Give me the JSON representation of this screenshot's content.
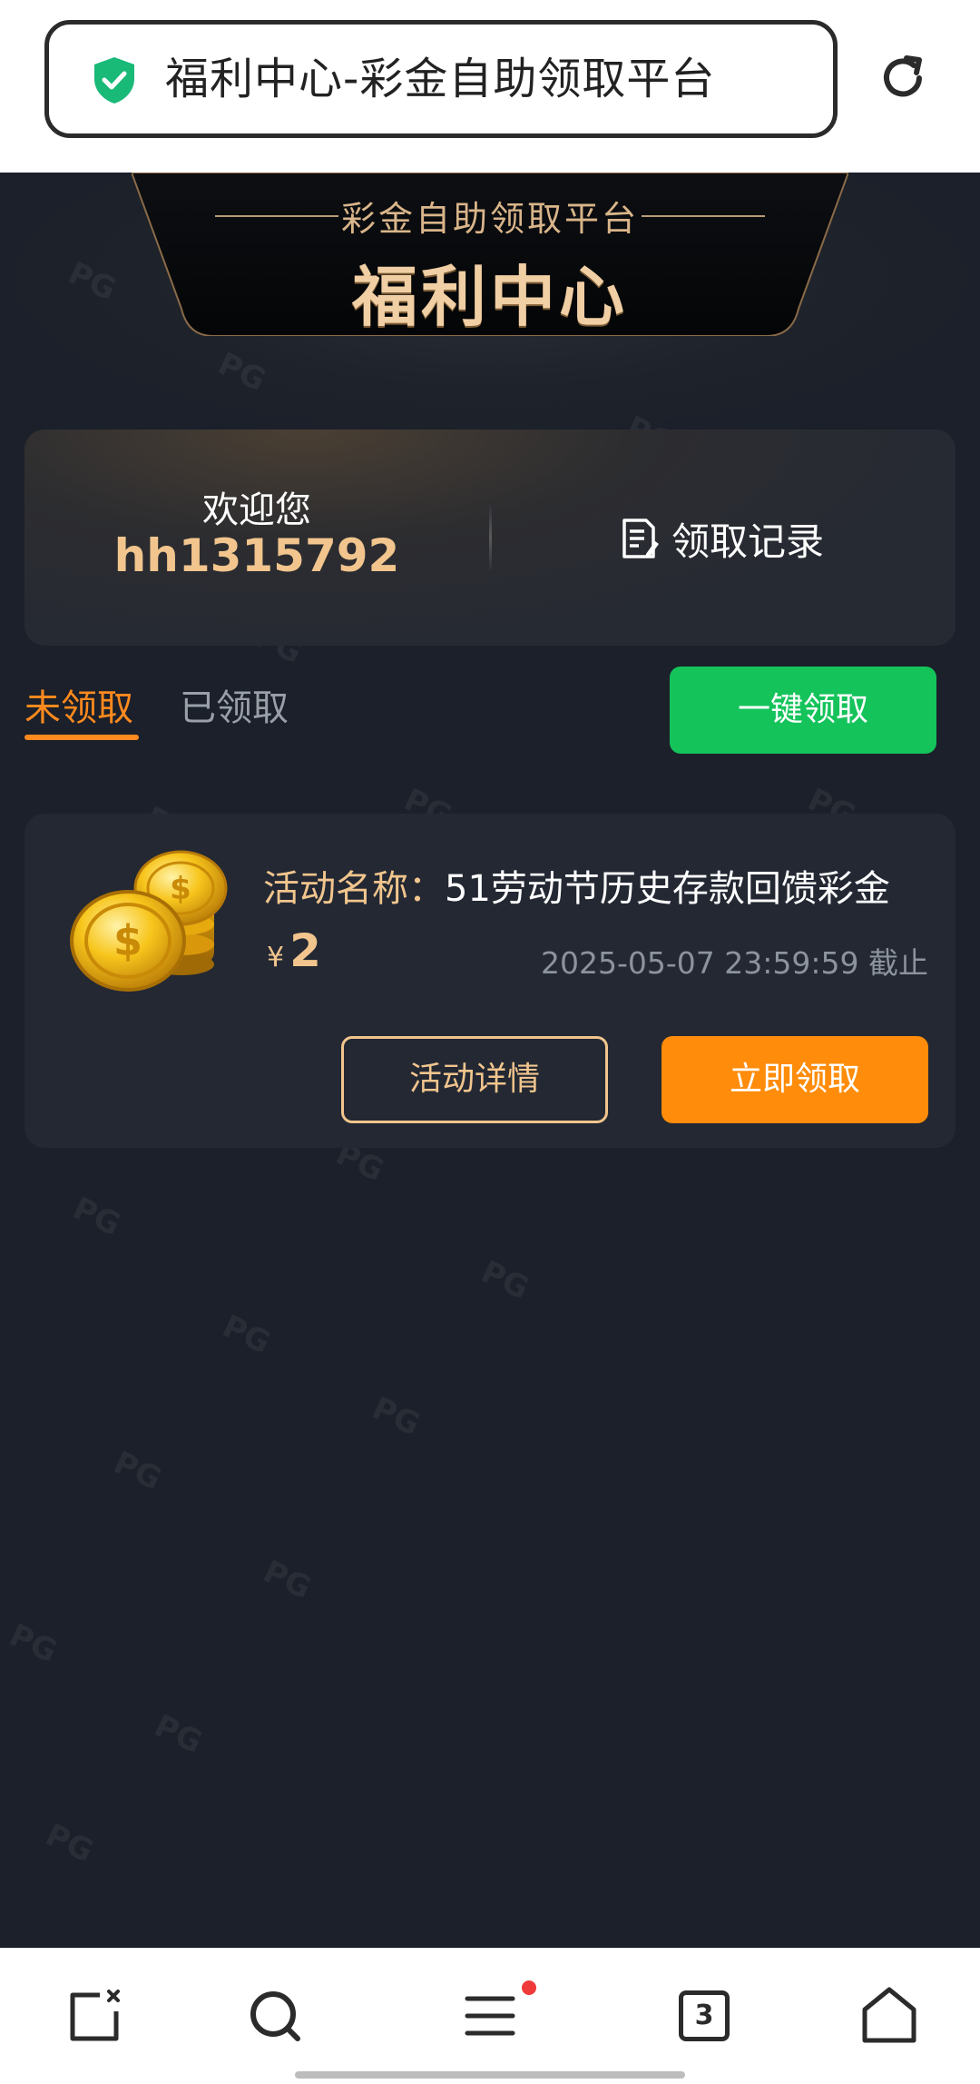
{
  "browser": {
    "address_title": "福利中心-彩金自助领取平台",
    "tab_count": "3"
  },
  "hero": {
    "subtitle": "彩金自助领取平台",
    "title": "福利中心"
  },
  "user": {
    "welcome": "欢迎您",
    "username": "hh1315792",
    "record_label": "领取记录"
  },
  "tabs": {
    "unclaimed": "未领取",
    "claimed": "已领取",
    "claim_all": "一键领取"
  },
  "activity": {
    "name_label": "活动名称：",
    "name": "51劳动节历史存款回馈彩金",
    "currency": "¥",
    "amount": "2",
    "deadline": "2025-05-07 23:59:59 截止",
    "detail_button": "活动详情",
    "claim_button": "立即领取"
  },
  "watermark": "PG",
  "colors": {
    "accent_orange": "#ff8c0a",
    "accent_green": "#14c35a",
    "gold": "#f1c58d",
    "page_bg": "#1b202a"
  }
}
